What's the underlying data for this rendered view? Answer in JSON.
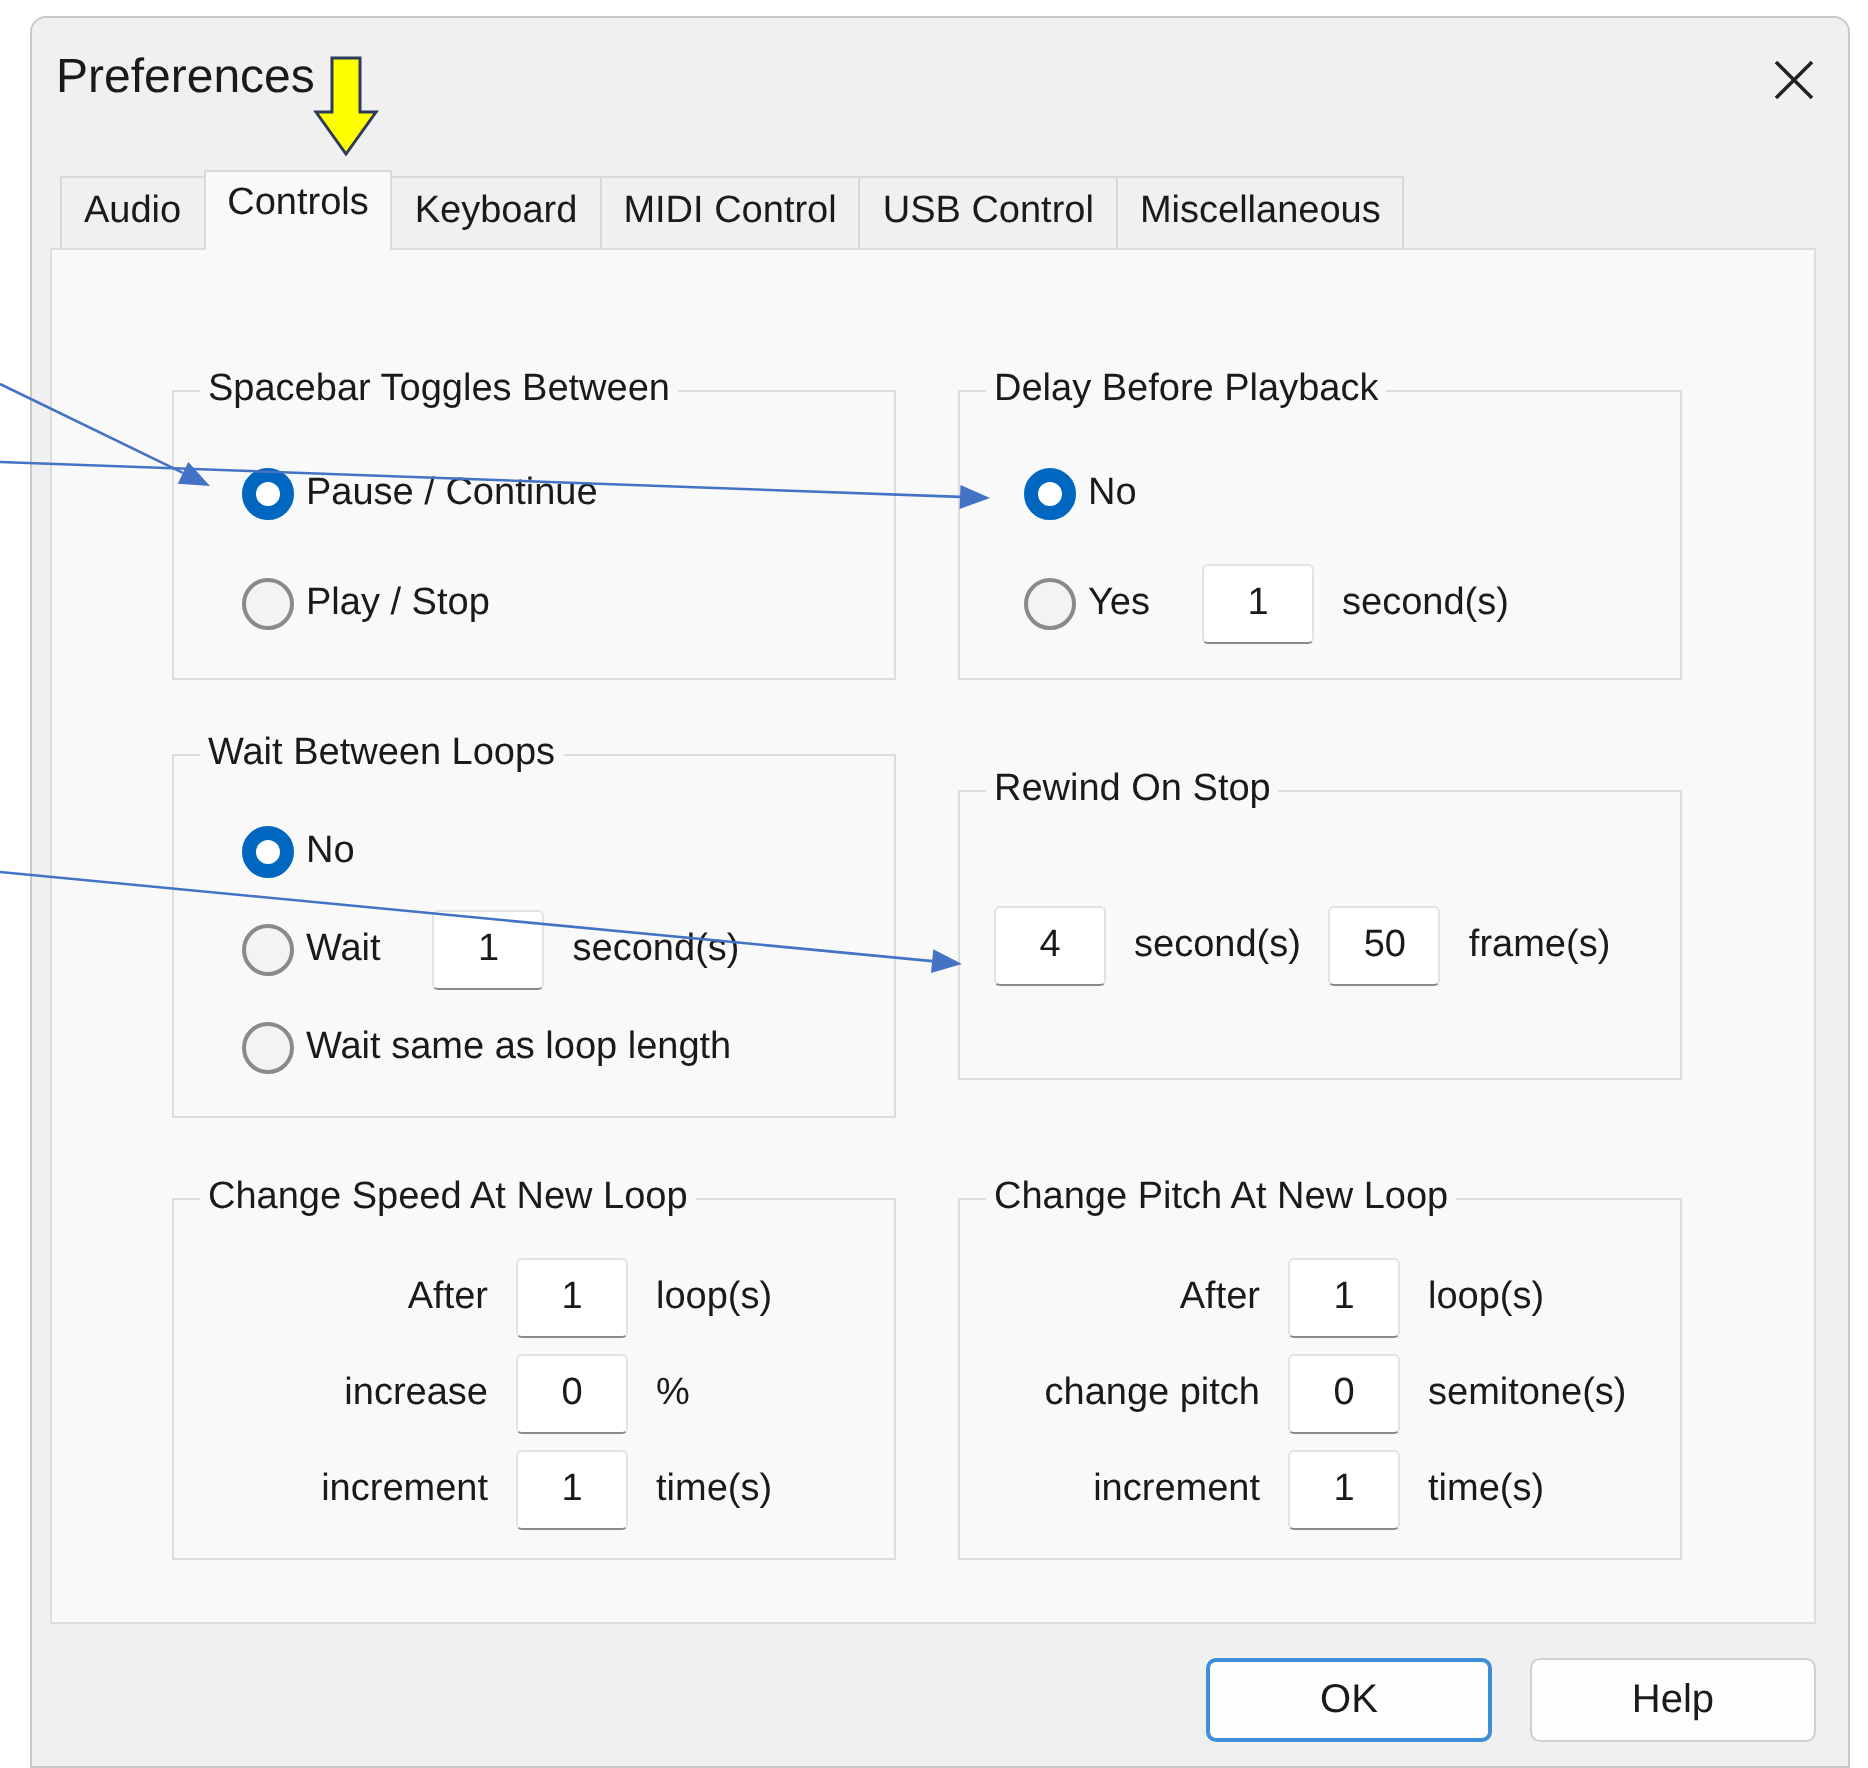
{
  "window": {
    "title": "Preferences"
  },
  "tabs": [
    {
      "label": "Audio",
      "selected": false
    },
    {
      "label": "Controls",
      "selected": true
    },
    {
      "label": "Keyboard",
      "selected": false
    },
    {
      "label": "MIDI Control",
      "selected": false
    },
    {
      "label": "USB Control",
      "selected": false
    },
    {
      "label": "Miscellaneous",
      "selected": false
    }
  ],
  "groups": [
    {
      "title": "Spacebar Toggles Between",
      "kind": "radios",
      "options": [
        {
          "label": "Pause / Continue",
          "selected": true
        },
        {
          "label": "Play / Stop",
          "selected": false
        }
      ]
    },
    {
      "title": "Delay Before Playback",
      "kind": "radios",
      "options": [
        {
          "label": "No",
          "selected": true
        },
        {
          "label": "Yes",
          "selected": false,
          "value": "1",
          "unit": "second(s)"
        }
      ]
    },
    {
      "title": "Wait Between Loops",
      "kind": "radios",
      "options": [
        {
          "label": "No",
          "selected": true
        },
        {
          "label": "Wait",
          "selected": false,
          "value": "1",
          "unit": "second(s)"
        },
        {
          "label": "Wait same as loop length",
          "selected": false
        }
      ]
    },
    {
      "title": "Rewind On Stop",
      "kind": "inline",
      "items": [
        {
          "value": "4",
          "unit": "second(s)"
        },
        {
          "value": "50",
          "unit": "frame(s)"
        }
      ]
    },
    {
      "title": "Change Speed At New Loop",
      "kind": "grid",
      "rows": [
        {
          "label": "After",
          "value": "1",
          "unit": "loop(s)"
        },
        {
          "label": "increase",
          "value": "0",
          "unit": "%"
        },
        {
          "label": "increment",
          "value": "1",
          "unit": "time(s)"
        }
      ]
    },
    {
      "title": "Change Pitch At New Loop",
      "kind": "grid",
      "rows": [
        {
          "label": "After",
          "value": "1",
          "unit": "loop(s)"
        },
        {
          "label": "change pitch",
          "value": "0",
          "unit": "semitone(s)"
        },
        {
          "label": "increment",
          "value": "1",
          "unit": "time(s)"
        }
      ]
    }
  ],
  "buttons": [
    {
      "label": "OK",
      "default": true
    },
    {
      "label": "Help",
      "default": false
    }
  ]
}
